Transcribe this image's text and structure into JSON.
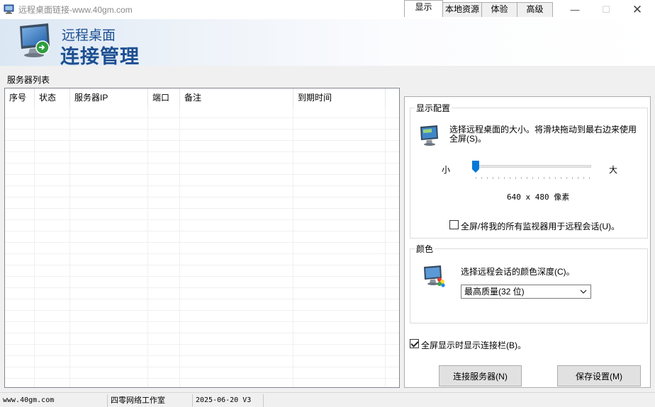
{
  "window": {
    "title": "远程桌面链接-www.40gm.com",
    "minimize_symbol": "—",
    "maximize_symbol": "☐",
    "close_symbol": "✕"
  },
  "banner": {
    "line1": "远程桌面",
    "line2": "连接管理"
  },
  "server_list": {
    "caption": "服务器列表",
    "columns": [
      "序号",
      "状态",
      "服务器IP",
      "端口",
      "备注",
      "到期时间"
    ],
    "rows": []
  },
  "tabs": [
    "显示",
    "本地资源",
    "体验",
    "高级"
  ],
  "active_tab": 0,
  "display": {
    "group_title": "显示配置",
    "description": "选择远程桌面的大小。将滑块拖动到最右边来使用全屏(S)。",
    "slider_min_label": "小",
    "slider_max_label": "大",
    "resolution_text": "640 x 480 像素",
    "slider_level_fraction": 0.0,
    "multi_monitor_label": "全屏/将我的所有监视器用于远程会话(U)。",
    "multi_monitor_checked": false
  },
  "color": {
    "group_title": "颜色",
    "description": "选择远程会话的颜色深度(C)。",
    "selected_depth": "最高质量(32 位)"
  },
  "show_connection_bar": {
    "label": "全屏显示时显示连接栏(B)。",
    "checked": true
  },
  "buttons": {
    "connect": "连接服务器(N)",
    "save": "保存设置(M)"
  },
  "statusbar": [
    "www.40gm.com",
    "四零网络工作室",
    "2025-06-20 V3",
    ""
  ],
  "colors": {
    "banner_text": "#1d4f91",
    "window_bg": "#f0f0f0"
  }
}
